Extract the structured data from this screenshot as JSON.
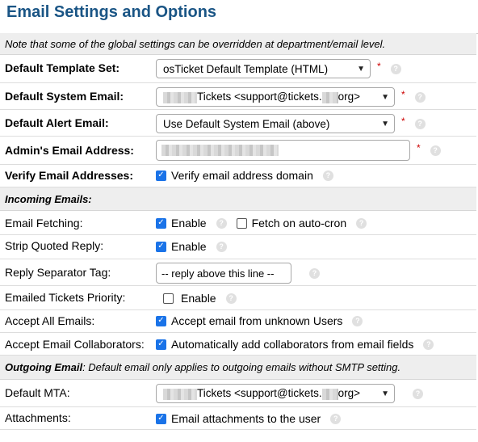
{
  "page": {
    "title": "Email Settings and Options"
  },
  "notice": "Note that some of the global settings can be overridden at department/email level.",
  "colors": {
    "title": "#1a5585",
    "checkbox": "#1a73e8",
    "required": "#cc0000",
    "section_bg": "#eeeeee"
  },
  "fields": {
    "default_template_set": {
      "label": "Default Template Set:",
      "value": "osTicket Default Template (HTML)",
      "required": "*"
    },
    "default_system_email": {
      "label": "Default System Email:",
      "value_prefix": "Tickets <support@tickets.",
      "value_suffix": "org>",
      "required": "*"
    },
    "default_alert_email": {
      "label": "Default Alert Email:",
      "value": "Use Default System Email (above)",
      "required": "*"
    },
    "admin_email": {
      "label": "Admin's Email Address:",
      "required": "*"
    },
    "verify_email": {
      "label": "Verify Email Addresses:",
      "checkbox_label": "Verify email address domain",
      "checked": true
    }
  },
  "incoming": {
    "section_title": "Incoming Emails:",
    "email_fetching": {
      "label": "Email Fetching:",
      "enable_label": "Enable",
      "enable_checked": true,
      "cron_label": "Fetch on auto-cron",
      "cron_checked": false
    },
    "strip_quoted": {
      "label": "Strip Quoted Reply:",
      "checkbox_label": "Enable",
      "checked": true
    },
    "reply_separator": {
      "label": "Reply Separator Tag:",
      "value": "-- reply above this line --"
    },
    "emailed_priority": {
      "label": "Emailed Tickets Priority:",
      "checkbox_label": "Enable",
      "checked": false
    },
    "accept_all": {
      "label": "Accept All Emails:",
      "checkbox_label": "Accept email from unknown Users",
      "checked": true
    },
    "accept_collab": {
      "label": "Accept Email Collaborators:",
      "checkbox_label": "Automatically add collaborators from email fields",
      "checked": true
    }
  },
  "outgoing": {
    "section_title": "Outgoing Email",
    "section_note": ": Default email only applies to outgoing emails without SMTP setting.",
    "default_mta": {
      "label": "Default MTA:",
      "value_prefix": "Tickets <support@tickets.",
      "value_suffix": "org>"
    },
    "attachments": {
      "label": "Attachments:",
      "checkbox_label": "Email attachments to the user",
      "checked": true
    }
  },
  "icons": {
    "help": "question-circle-icon",
    "dropdown": "chevron-down-icon",
    "check": "checkmark-icon"
  }
}
